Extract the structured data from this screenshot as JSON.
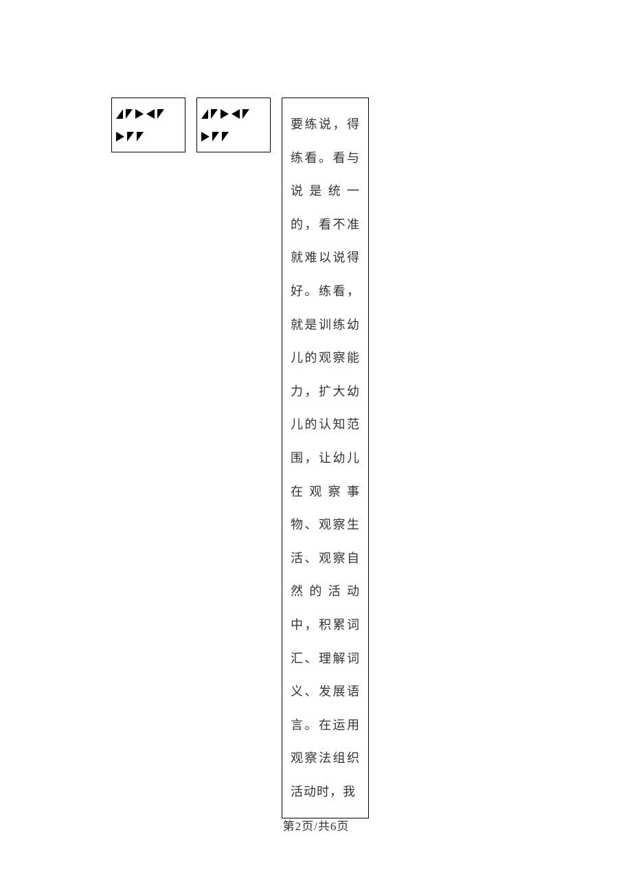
{
  "boxes": {
    "box1_glyphs": "◢◣◤◥◣ ◤◣◣",
    "box2_glyphs": "◢◣◤◥◣ ◤◣◣"
  },
  "text_content": "要练说，得练看。看与说是统一的，看不准就难以说得好。练看，就是训练幼儿的观察能力，扩大幼儿的认知范围，让幼儿在观察事物、观察生活、观察自然的活动中，积累词汇、理解词义、发展语言。在运用观察法组织活动时，我",
  "footer": "第2页/共6页"
}
